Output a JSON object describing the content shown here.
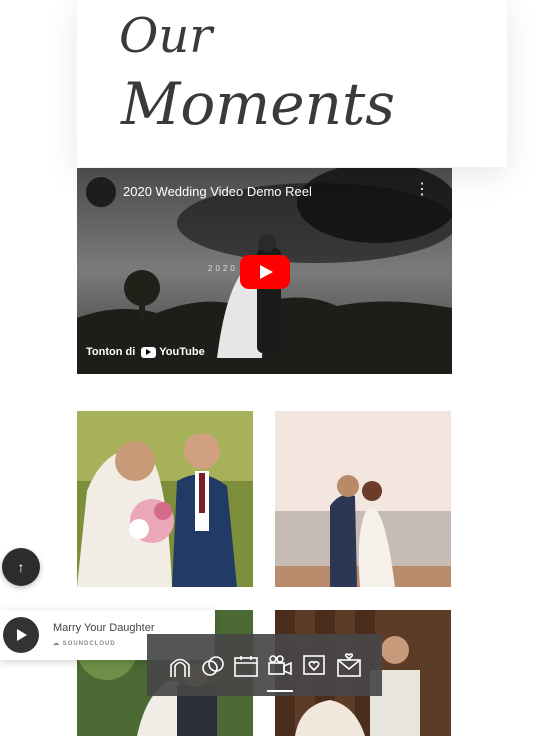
{
  "page": {
    "title_line1": "Our",
    "title_line2": "Moments"
  },
  "video": {
    "title": "2020 Wedding Video Demo Reel",
    "overlay_text": "2020  REEL",
    "watch_label": "Tonton di",
    "youtube_label": "YouTube"
  },
  "player": {
    "track": "Marry Your Daughter",
    "source": "SOUNDCLOUD"
  },
  "nav": {
    "items": [
      "arch-icon",
      "rings-icon",
      "calendar-icon",
      "video-camera-icon",
      "photo-heart-icon",
      "love-letter-icon"
    ],
    "active": "video-camera-icon"
  }
}
